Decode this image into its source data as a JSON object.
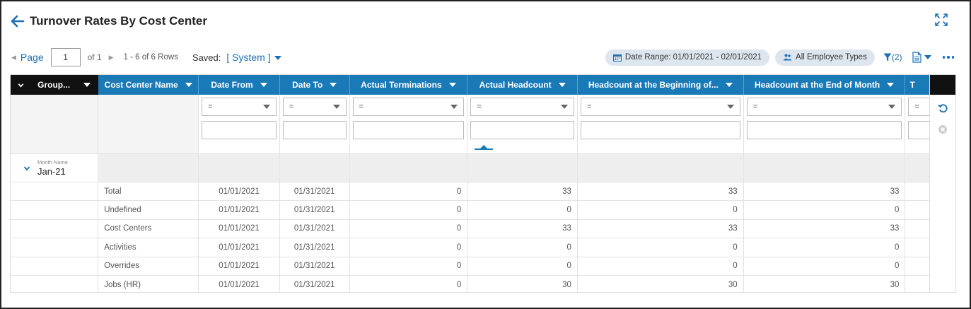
{
  "header": {
    "title": "Turnover Rates By Cost Center"
  },
  "toolbar": {
    "page_label": "Page",
    "page_value": "1",
    "of_text": "of 1",
    "rows_text": "1 - 6 of 6 Rows",
    "saved_label": "Saved:",
    "saved_value": "[ System ]",
    "date_range": "Date Range: 01/01/2021 - 02/01/2021",
    "employee_types": "All Employee Types",
    "filter_count": "(2)"
  },
  "grid": {
    "columns": [
      "Group...",
      "Cost Center Name",
      "Date From",
      "Date To",
      "Actual Terminations",
      "Actual Headcount",
      "Headcount at the Beginning of...",
      "Headcount at the End of Month",
      "T"
    ],
    "filter_operator": "=",
    "group": {
      "label": "Month Name",
      "value": "Jan-21"
    },
    "rows": [
      {
        "name": "Total",
        "from": "01/01/2021",
        "to": "01/31/2021",
        "terms": "0",
        "headcount": "33",
        "begin": "33",
        "end": "33"
      },
      {
        "name": "Undefined",
        "from": "01/01/2021",
        "to": "01/31/2021",
        "terms": "0",
        "headcount": "0",
        "begin": "0",
        "end": "0"
      },
      {
        "name": "Cost Centers",
        "from": "01/01/2021",
        "to": "01/31/2021",
        "terms": "0",
        "headcount": "33",
        "begin": "33",
        "end": "33"
      },
      {
        "name": "Activities",
        "from": "01/01/2021",
        "to": "01/31/2021",
        "terms": "0",
        "headcount": "0",
        "begin": "0",
        "end": "0"
      },
      {
        "name": "Overrides",
        "from": "01/01/2021",
        "to": "01/31/2021",
        "terms": "0",
        "headcount": "0",
        "begin": "0",
        "end": "0"
      },
      {
        "name": "Jobs (HR)",
        "from": "01/01/2021",
        "to": "01/31/2021",
        "terms": "0",
        "headcount": "30",
        "begin": "30",
        "end": "30"
      }
    ]
  },
  "colors": {
    "accent": "#1a6fb5",
    "header_bg": "#1a7ab8",
    "group_header_bg": "#111111",
    "chip_bg": "#dde6ef"
  }
}
